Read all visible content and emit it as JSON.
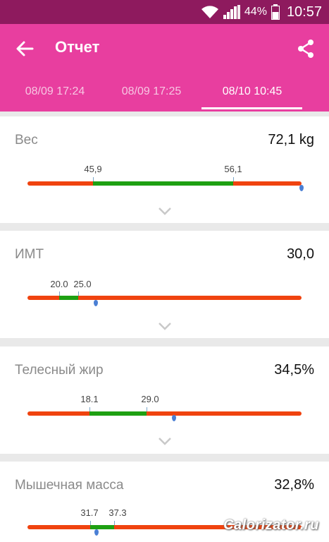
{
  "status": {
    "battery": "44%",
    "time": "10:57"
  },
  "appbar": {
    "title": "Отчет"
  },
  "tabs": [
    {
      "label": "08/09 17:24"
    },
    {
      "label": "08/09 17:25"
    },
    {
      "label": "08/10 10:45"
    }
  ],
  "metrics": [
    {
      "label": "Вес",
      "value": "72,1 kg",
      "low": "45,9",
      "high": "56,1"
    },
    {
      "label": "ИМТ",
      "value": "30,0",
      "low": "20.0",
      "high": "25.0"
    },
    {
      "label": "Телесный жир",
      "value": "34,5%",
      "low": "18.1",
      "high": "29.0"
    },
    {
      "label": "Мышечная масса",
      "value": "32,8%",
      "low": "31.7",
      "high": "37.3"
    }
  ],
  "watermark": "Calorizator.ru",
  "colors": {
    "accent": "#e83e9f",
    "statusbar": "#8e1a5e",
    "range_normal": "#1ea012",
    "range_out": "#f0430f"
  }
}
